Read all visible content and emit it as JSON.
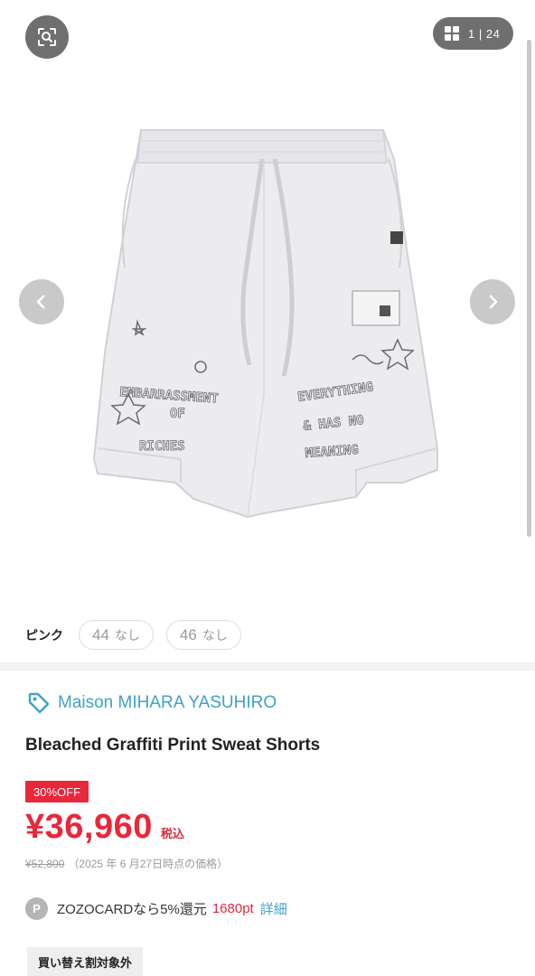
{
  "gallery": {
    "counter_current": "1",
    "counter_total": "24",
    "icons": {
      "lens": "image-search-icon",
      "grid": "grid-icon",
      "prev": "chevron-left-icon",
      "next": "chevron-right-icon"
    },
    "image_text": {
      "left_leg": [
        "EMBARRASSMENT",
        "OF",
        "RICHES"
      ],
      "right_leg": [
        "EVERYTHING",
        "& HAS NO",
        "MEANING"
      ]
    }
  },
  "variants": {
    "color": "ピンク",
    "sizes": [
      {
        "size": "44",
        "stock": "なし"
      },
      {
        "size": "46",
        "stock": "なし"
      }
    ]
  },
  "product": {
    "brand": "Maison MIHARA YASUHIRO",
    "brand_icon": "tag-icon",
    "title": "Bleached Graffiti Print Sweat Shorts",
    "discount": "30%OFF",
    "price": "¥36,960",
    "tax": "税込",
    "original_price": "¥52,800",
    "price_date_note": "（2025 年 6 月27日時点の価格）",
    "points": {
      "icon_letter": "P",
      "text": "ZOZOCARDなら5%還元",
      "value": "1680pt",
      "link": "詳細"
    },
    "badge": "買い替え割対象外"
  },
  "colors": {
    "accent_blue": "#3fa1c7",
    "sale_red": "#e8273a",
    "overlay_gray": "#6f6f6f"
  }
}
